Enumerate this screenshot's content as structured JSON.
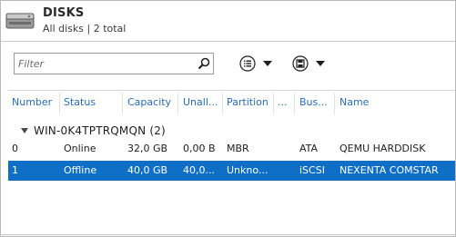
{
  "header": {
    "title": "DISKS",
    "subtitle": "All disks | 2 total"
  },
  "toolbar": {
    "filter_placeholder": "Filter",
    "search_icon": "search-icon",
    "tasks_icon": "list-icon",
    "save_icon": "save-icon"
  },
  "columns": [
    "Number",
    "Status",
    "Capacity",
    "Unall...",
    "Partition",
    "...",
    "Bus...",
    "Name"
  ],
  "group": {
    "label": "WIN-0K4TPTRQMQN (2)"
  },
  "rows": [
    {
      "number": "0",
      "status": "Online",
      "capacity": "32,0 GB",
      "unallocated": "0,00 B",
      "partition": "MBR",
      "readonly": "",
      "bus": "ATA",
      "name": "QEMU HARDDISK",
      "selected": false
    },
    {
      "number": "1",
      "status": "Offline",
      "capacity": "40,0 GB",
      "unallocated": "40,0...",
      "partition": "Unkno...",
      "readonly": "",
      "bus": "iSCSI",
      "name": "NEXENTA COMSTAR",
      "selected": true
    }
  ],
  "colors": {
    "selection": "#0f6fc6",
    "header_text": "#2b6cb5"
  }
}
